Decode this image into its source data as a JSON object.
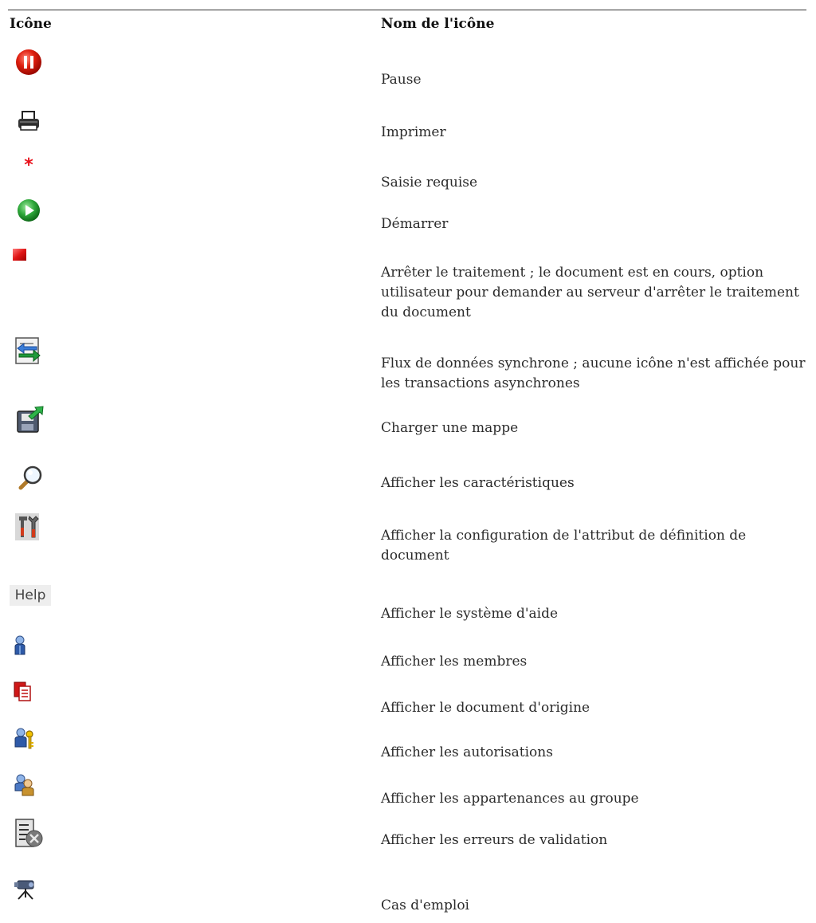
{
  "table": {
    "header_icon": "Icône",
    "header_name": "Nom de l'icône",
    "rows": [
      {
        "icon": "pause-icon",
        "name": "Pause"
      },
      {
        "icon": "printer-icon",
        "name": "Imprimer"
      },
      {
        "icon": "required-asterisk-icon",
        "name": "Saisie requise"
      },
      {
        "icon": "start-icon",
        "name": "Démarrer"
      },
      {
        "icon": "stop-icon",
        "name": "Arrêter le traitement ; le document est en cours, option utilisateur pour demander au serveur d'arrêter le traitement du document"
      },
      {
        "icon": "synchronous-flow-icon",
        "name": "Flux de données synchrone ; aucune icône n'est affichée pour les transactions asynchrones"
      },
      {
        "icon": "load-map-icon",
        "name": "Charger une mappe"
      },
      {
        "icon": "magnifier-icon",
        "name": "Afficher les caractéristiques"
      },
      {
        "icon": "tools-icon",
        "name": "Afficher la configuration de l'attribut de définition de document"
      },
      {
        "icon": "help-button-icon",
        "name": "Afficher le système d'aide",
        "label": "Help"
      },
      {
        "icon": "member-icon",
        "name": "Afficher les membres"
      },
      {
        "icon": "source-document-icon",
        "name": "Afficher le document d'origine"
      },
      {
        "icon": "permissions-icon",
        "name": "Afficher les autorisations"
      },
      {
        "icon": "group-membership-icon",
        "name": "Afficher les appartenances au groupe"
      },
      {
        "icon": "validation-errors-icon",
        "name": "Afficher les erreurs de validation"
      },
      {
        "icon": "where-used-icon",
        "name": "Cas d'emploi"
      }
    ]
  }
}
